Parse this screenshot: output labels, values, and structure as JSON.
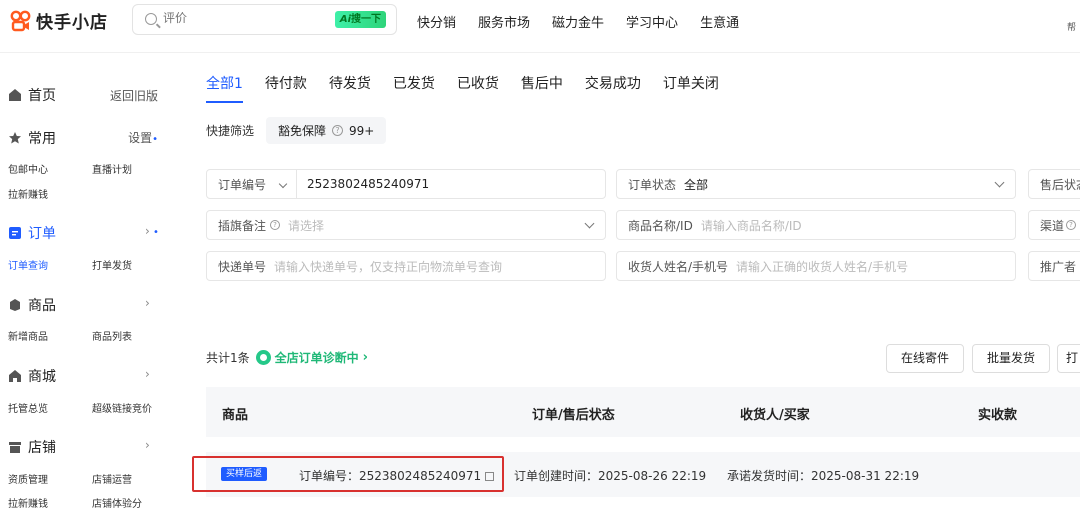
{
  "header": {
    "brand": "快手小店",
    "search_placeholder": "评价",
    "ai_button": "搜一下",
    "nav": [
      "快分销",
      "服务市场",
      "磁力金牛",
      "学习中心",
      "生意通"
    ],
    "right_char": "帮"
  },
  "sidebar": {
    "home": "首页",
    "back_old": "返回旧版",
    "common": "常用",
    "settings": "设置",
    "common_links": [
      "包邮中心",
      "直播计划",
      "拉新赚钱"
    ],
    "orders": "订单",
    "order_links": [
      "订单查询",
      "打单发货"
    ],
    "goods": "商品",
    "goods_links": [
      "新增商品",
      "商品列表"
    ],
    "mall": "商城",
    "mall_links": [
      "托管总览",
      "超级链接竞价"
    ],
    "shop": "店铺",
    "shop_links": [
      "资质管理",
      "店铺运营",
      "拉新赚钱",
      "店铺体验分"
    ]
  },
  "tabs": [
    "全部1",
    "待付款",
    "待发货",
    "已发货",
    "已收货",
    "售后中",
    "交易成功",
    "订单关闭"
  ],
  "quick_filter": {
    "label": "快捷筛选",
    "chip": "豁免保障",
    "chip_count": "99+"
  },
  "filters": {
    "order_no_label": "订单编号",
    "order_no_value": "2523802485240971",
    "status_label": "订单状态",
    "status_value": "全部",
    "aftersale_label": "售后状态",
    "flag_label": "插旗备注",
    "flag_placeholder": "请选择",
    "product_label": "商品名称/ID",
    "product_placeholder": "请输入商品名称/ID",
    "channel_label": "渠道",
    "express_label": "快递单号",
    "express_placeholder": "请输入快递单号，仅支持正向物流单号查询",
    "receiver_label": "收货人姓名/手机号",
    "receiver_placeholder": "请输入正确的收货人姓名/手机号",
    "promoter_label": "推广者"
  },
  "summary": {
    "total": "共计1条",
    "diagnosis": "全店订单诊断中"
  },
  "actions": {
    "online_ship": "在线寄件",
    "batch_ship": "批量发货",
    "print": "打"
  },
  "table": {
    "headers": [
      "商品",
      "订单/售后状态",
      "收货人/买家",
      "实收款"
    ],
    "row": {
      "badge": "买样后返",
      "order_no": "订单编号：2523802485240971",
      "created": "订单创建时间：2025-08-26 22:19",
      "promise": "承诺发货时间：2025-08-31 22:19"
    }
  },
  "colors": {
    "accent": "#1f5cff",
    "highlight_border": "#d8312f",
    "diag_green": "#1fb877"
  }
}
